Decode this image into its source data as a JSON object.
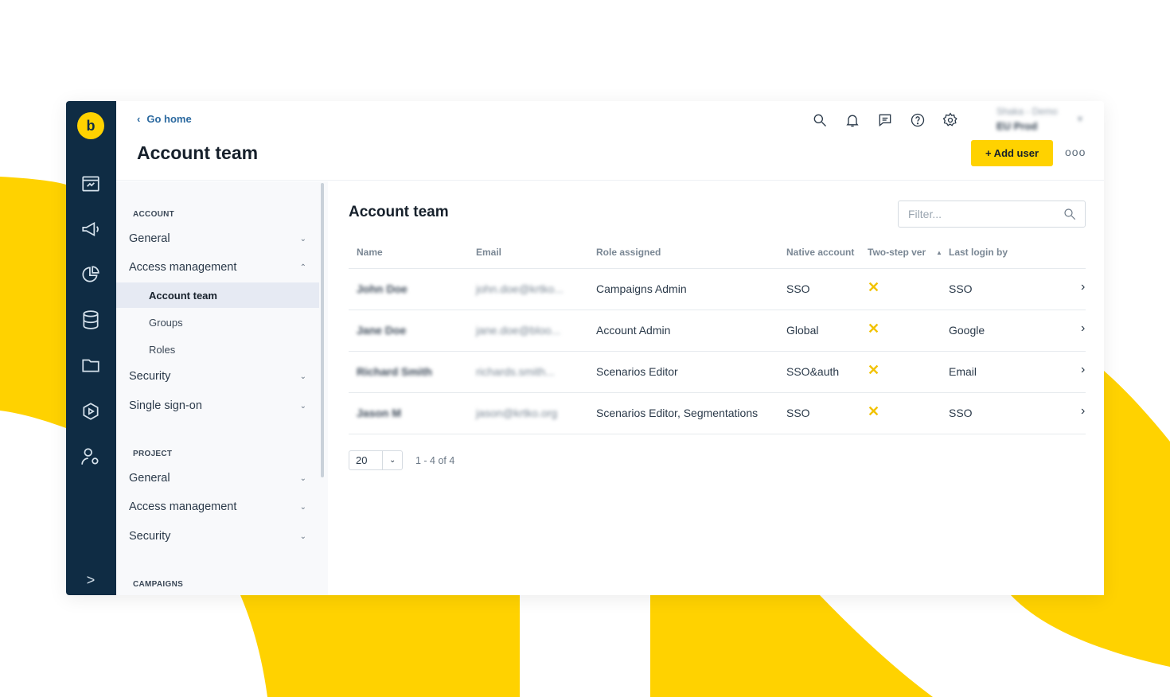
{
  "header": {
    "back_link": "Go home",
    "title": "Account team",
    "account_org": "Shaka - Demo",
    "account_env": "EU Prod",
    "add_user_label": "+ Add user",
    "more_label": "ooo"
  },
  "rail": {
    "logo_letter": "b",
    "icons": [
      "dashboard-icon",
      "megaphone-icon",
      "pie-chart-icon",
      "database-icon",
      "folder-icon",
      "play-circle-icon",
      "user-settings-icon"
    ],
    "expand_label": ">"
  },
  "subnav": {
    "sections": [
      {
        "label": "ACCOUNT",
        "items": [
          {
            "label": "General"
          },
          {
            "label": "Access management",
            "expanded": true,
            "children": [
              "Account team",
              "Groups",
              "Roles"
            ],
            "active_child": "Account team"
          },
          {
            "label": "Security"
          },
          {
            "label": "Single sign-on"
          }
        ]
      },
      {
        "label": "PROJECT",
        "items": [
          {
            "label": "General"
          },
          {
            "label": "Access management"
          },
          {
            "label": "Security"
          }
        ]
      },
      {
        "label": "CAMPAIGNS",
        "items": []
      }
    ]
  },
  "main": {
    "title": "Account team",
    "filter_placeholder": "Filter...",
    "columns": [
      "Name",
      "Email",
      "Role assigned",
      "Native account",
      "Two-step ver",
      "Last login by"
    ],
    "sort_indicator": "▲",
    "rows": [
      {
        "name": "John Doe",
        "email": "john.doe@krtko...",
        "role": "Campaigns Admin",
        "native": "SSO",
        "two_step": "✕",
        "last_login": "SSO"
      },
      {
        "name": "Jane Doe",
        "email": "jane.doe@bloo...",
        "role": "Account Admin",
        "native": "Global",
        "two_step": "✕",
        "last_login": "Google"
      },
      {
        "name": "Richard Smith",
        "email": "richards.smith...",
        "role": "Scenarios Editor",
        "native": "SSO&auth",
        "two_step": "✕",
        "last_login": "Email"
      },
      {
        "name": "Jason M",
        "email": "jason@krtko.org",
        "role": "Scenarios Editor,  Segmentations",
        "native": "SSO",
        "two_step": "✕",
        "last_login": "SSO"
      }
    ],
    "pager": {
      "page_size": "20",
      "range": "1 - 4 of 4"
    }
  },
  "colors": {
    "brand_yellow": "#ffd200",
    "rail_navy": "#0f2c44",
    "link_blue": "#2c6aa0"
  }
}
